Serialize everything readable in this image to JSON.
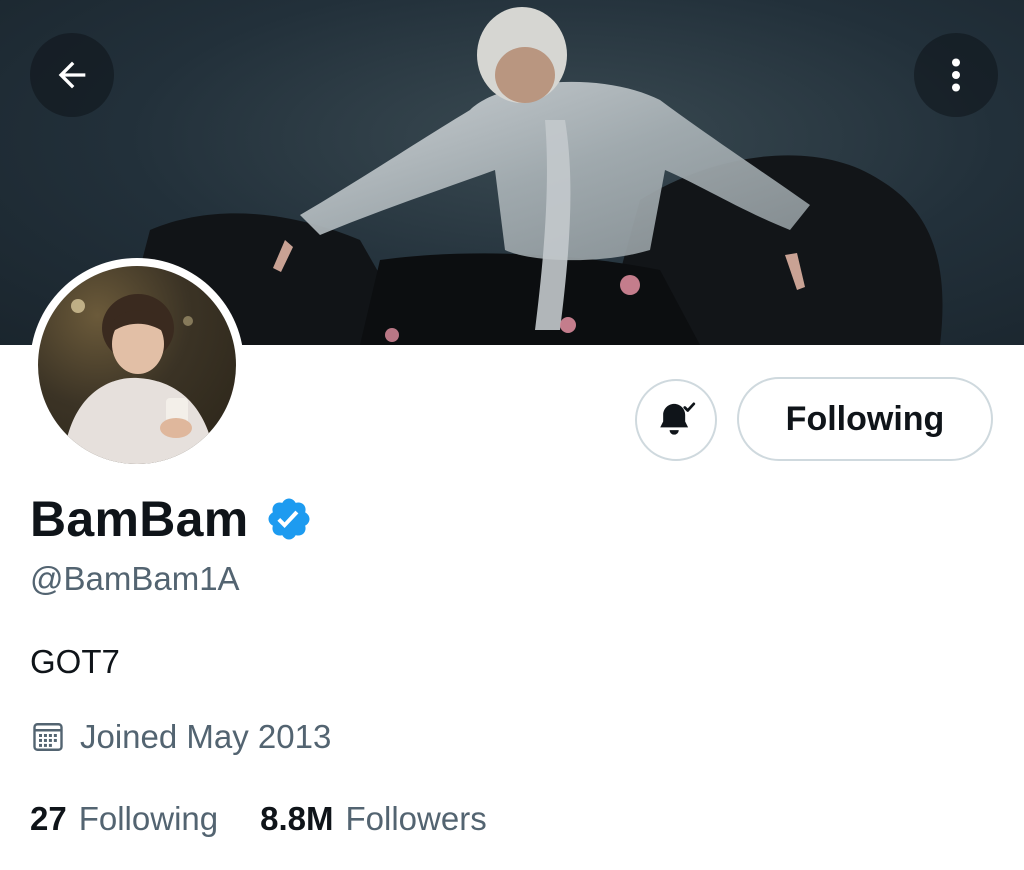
{
  "profile": {
    "display_name": "BamBam",
    "handle": "@BamBam1A",
    "bio": "GOT7",
    "joined": "Joined May 2013",
    "verified": true
  },
  "actions": {
    "following_label": "Following",
    "notification_icon": "bell-check-icon",
    "back_icon": "arrow-left-icon",
    "more_icon": "vertical-dots-icon"
  },
  "stats": {
    "following_count": "27",
    "following_label": "Following",
    "followers_count": "8.8M",
    "followers_label": "Followers"
  },
  "colors": {
    "verified": "#1d9bf0",
    "primary_text": "#0f1419",
    "secondary_text": "#536471",
    "button_border": "#cfd9de"
  }
}
